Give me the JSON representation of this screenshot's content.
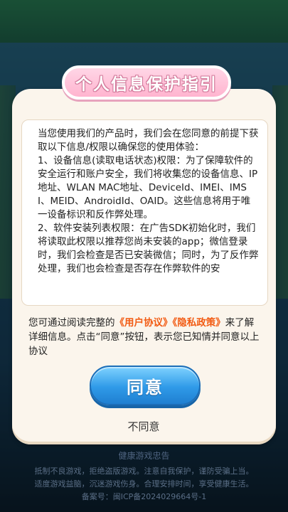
{
  "dialog": {
    "title": "个人信息保护指引",
    "content": [
      "当您使用我们的产品时，我们会在您同意的前提下获取以下信息/权限以确保您的使用体验：",
      "1、设备信息(读取电话状态)权限：为了保障软件的安全运行和账户安全，我们将收集您的设备信息、IP地址、WLAN MAC地址、DeviceId、IMEI、IMSI、MEID、AndroidId、OAID。这些信息将用于唯一设备标识和反作弊处理。",
      "2、软件安装列表权限：在广告SDK初始化时，我们将读取此权限以推荐您尚未安装的app；微信登录时，我们会检查是否已安装微信；同时，为了反作弊处理，我们也会检查是否存在作弊软件的安"
    ],
    "notice": {
      "prefix": "您可通过阅读完整的",
      "user_agreement": "《用户协议》",
      "privacy_policy": "《隐私政策》",
      "suffix": "来了解详细信息。点击“同意”按钮，表示您已知情并同意以上协议"
    },
    "agree_label": "同意",
    "disagree_label": "不同意"
  },
  "footer": {
    "title": "健康游戏忠告",
    "line1": "抵制不良游戏，拒绝盗版游戏。注意自我保护，谨防受骗上当。",
    "line2": "适度游戏益脑，沉迷游戏伤身。合理安排时间，享受健康生活。",
    "line3": "备案号：闽ICP备2024029664号-1"
  }
}
